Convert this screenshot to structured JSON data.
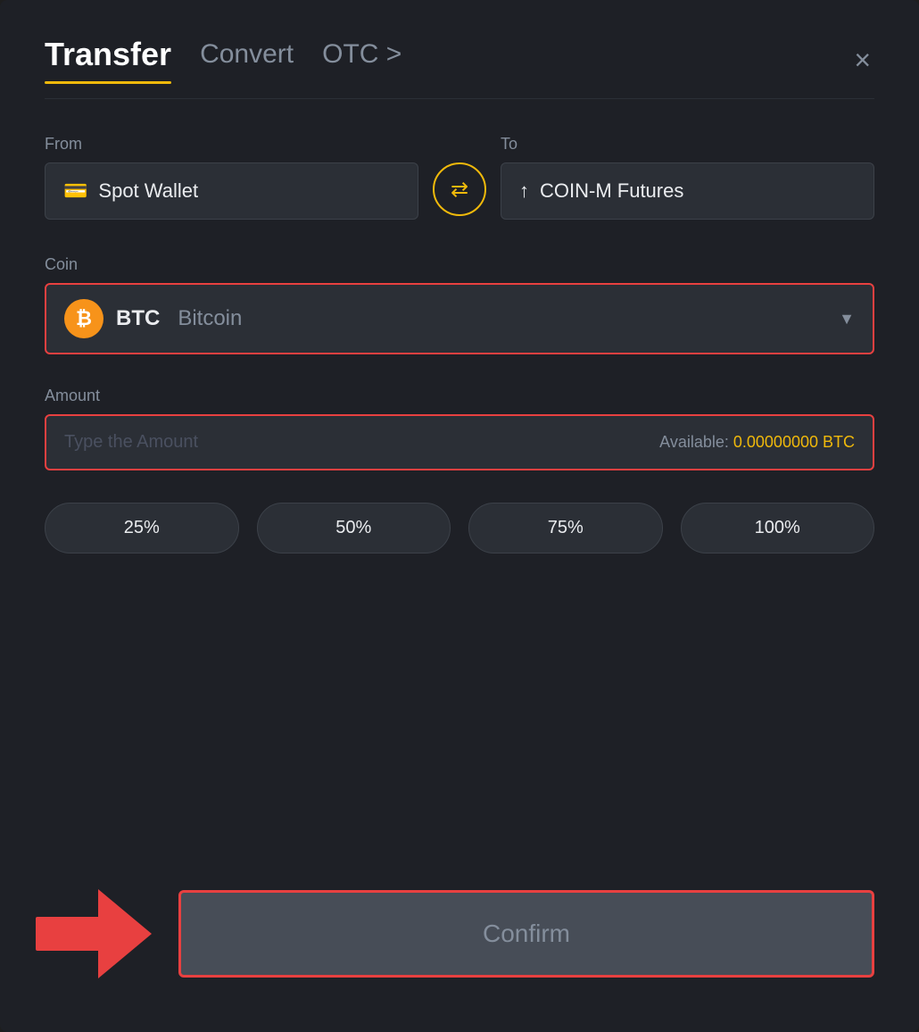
{
  "modal": {
    "title": "Transfer",
    "tabs": [
      {
        "id": "transfer",
        "label": "Transfer",
        "active": true
      },
      {
        "id": "convert",
        "label": "Convert",
        "active": false
      },
      {
        "id": "otc",
        "label": "OTC >",
        "active": false
      }
    ],
    "close_label": "×"
  },
  "from_section": {
    "label": "From",
    "wallet": "Spot Wallet",
    "wallet_icon": "💳"
  },
  "swap_button": {
    "icon": "⇄"
  },
  "to_section": {
    "label": "To",
    "wallet": "COIN-M Futures",
    "wallet_icon": "↑"
  },
  "coin_section": {
    "label": "Coin",
    "selected_coin": "BTC",
    "selected_name": "Bitcoin",
    "icon_symbol": "₿"
  },
  "amount_section": {
    "label": "Amount",
    "placeholder": "Type the Amount",
    "available_label": "Available:",
    "available_value": "0.00000000 BTC"
  },
  "percent_buttons": [
    {
      "label": "25%"
    },
    {
      "label": "50%"
    },
    {
      "label": "75%"
    },
    {
      "label": "100%"
    }
  ],
  "confirm_button": {
    "label": "Confirm"
  }
}
